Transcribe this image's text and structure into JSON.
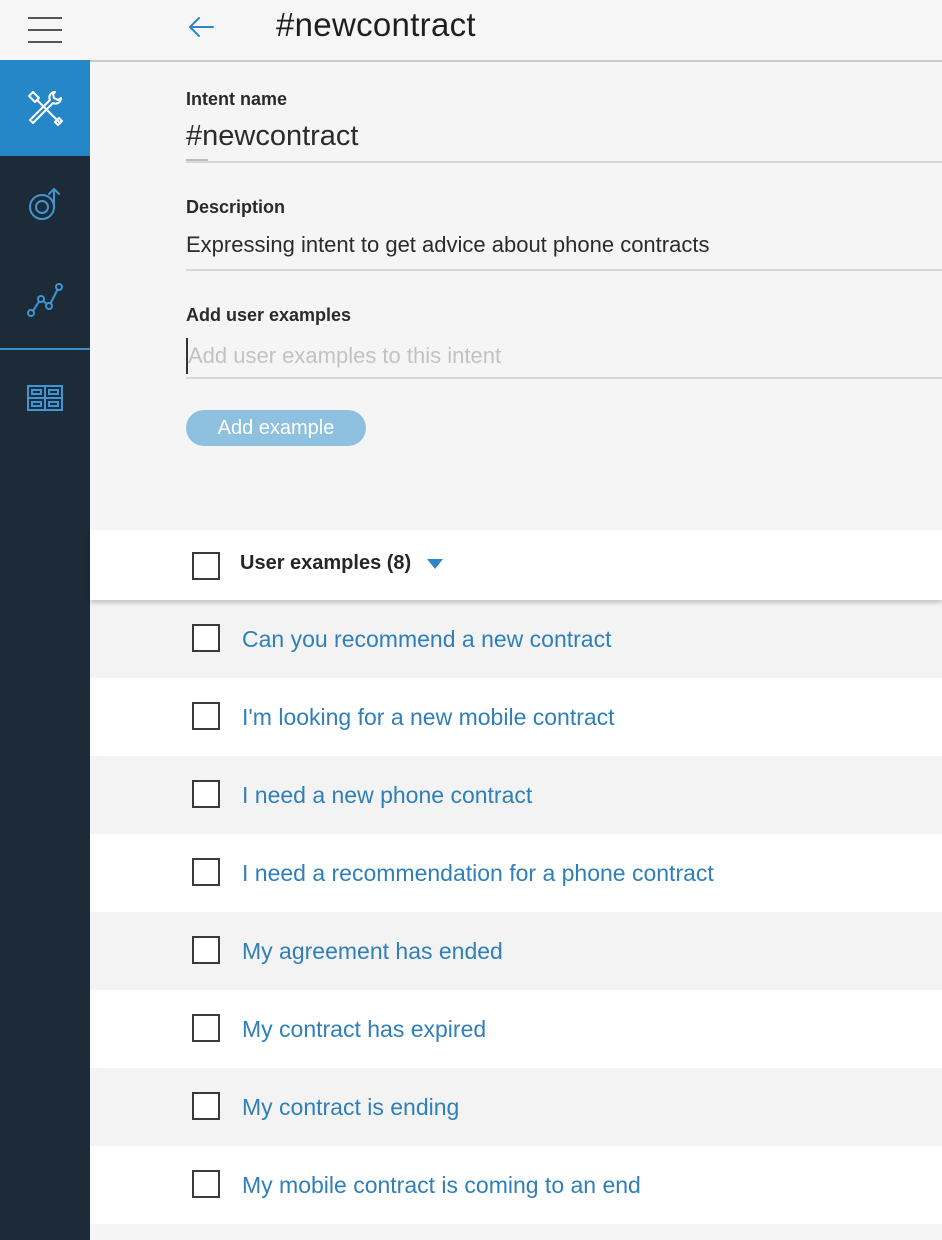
{
  "header": {
    "title": "#newcontract"
  },
  "sidebar": {
    "items": [
      {
        "icon": "tools-icon",
        "active": true
      },
      {
        "icon": "dialog-icon",
        "active": false
      },
      {
        "icon": "analytics-icon",
        "active": false
      },
      {
        "icon": "workspaces-icon",
        "active": false
      }
    ]
  },
  "form": {
    "intent_name_label": "Intent name",
    "intent_name_value": "#newcontract",
    "description_label": "Description",
    "description_value": "Expressing intent to get advice about phone contracts",
    "examples_label": "Add user examples",
    "examples_placeholder": "Add user examples to this intent",
    "add_button_label": "Add example"
  },
  "examples": {
    "header_label": "User examples (8)",
    "items": [
      {
        "text": "Can you recommend a new contract"
      },
      {
        "text": "I'm looking for a new mobile contract"
      },
      {
        "text": "I need a new phone contract"
      },
      {
        "text": "I need a recommendation for a phone contract"
      },
      {
        "text": "My agreement has ended"
      },
      {
        "text": "My contract has expired"
      },
      {
        "text": "My contract is ending"
      },
      {
        "text": "My mobile contract is coming to an end"
      }
    ]
  },
  "colors": {
    "sidebar_bg": "#1d2a37",
    "sidebar_active": "#2586c8",
    "link_blue": "#2f7fb8",
    "button_bg": "#8ec1e0"
  }
}
